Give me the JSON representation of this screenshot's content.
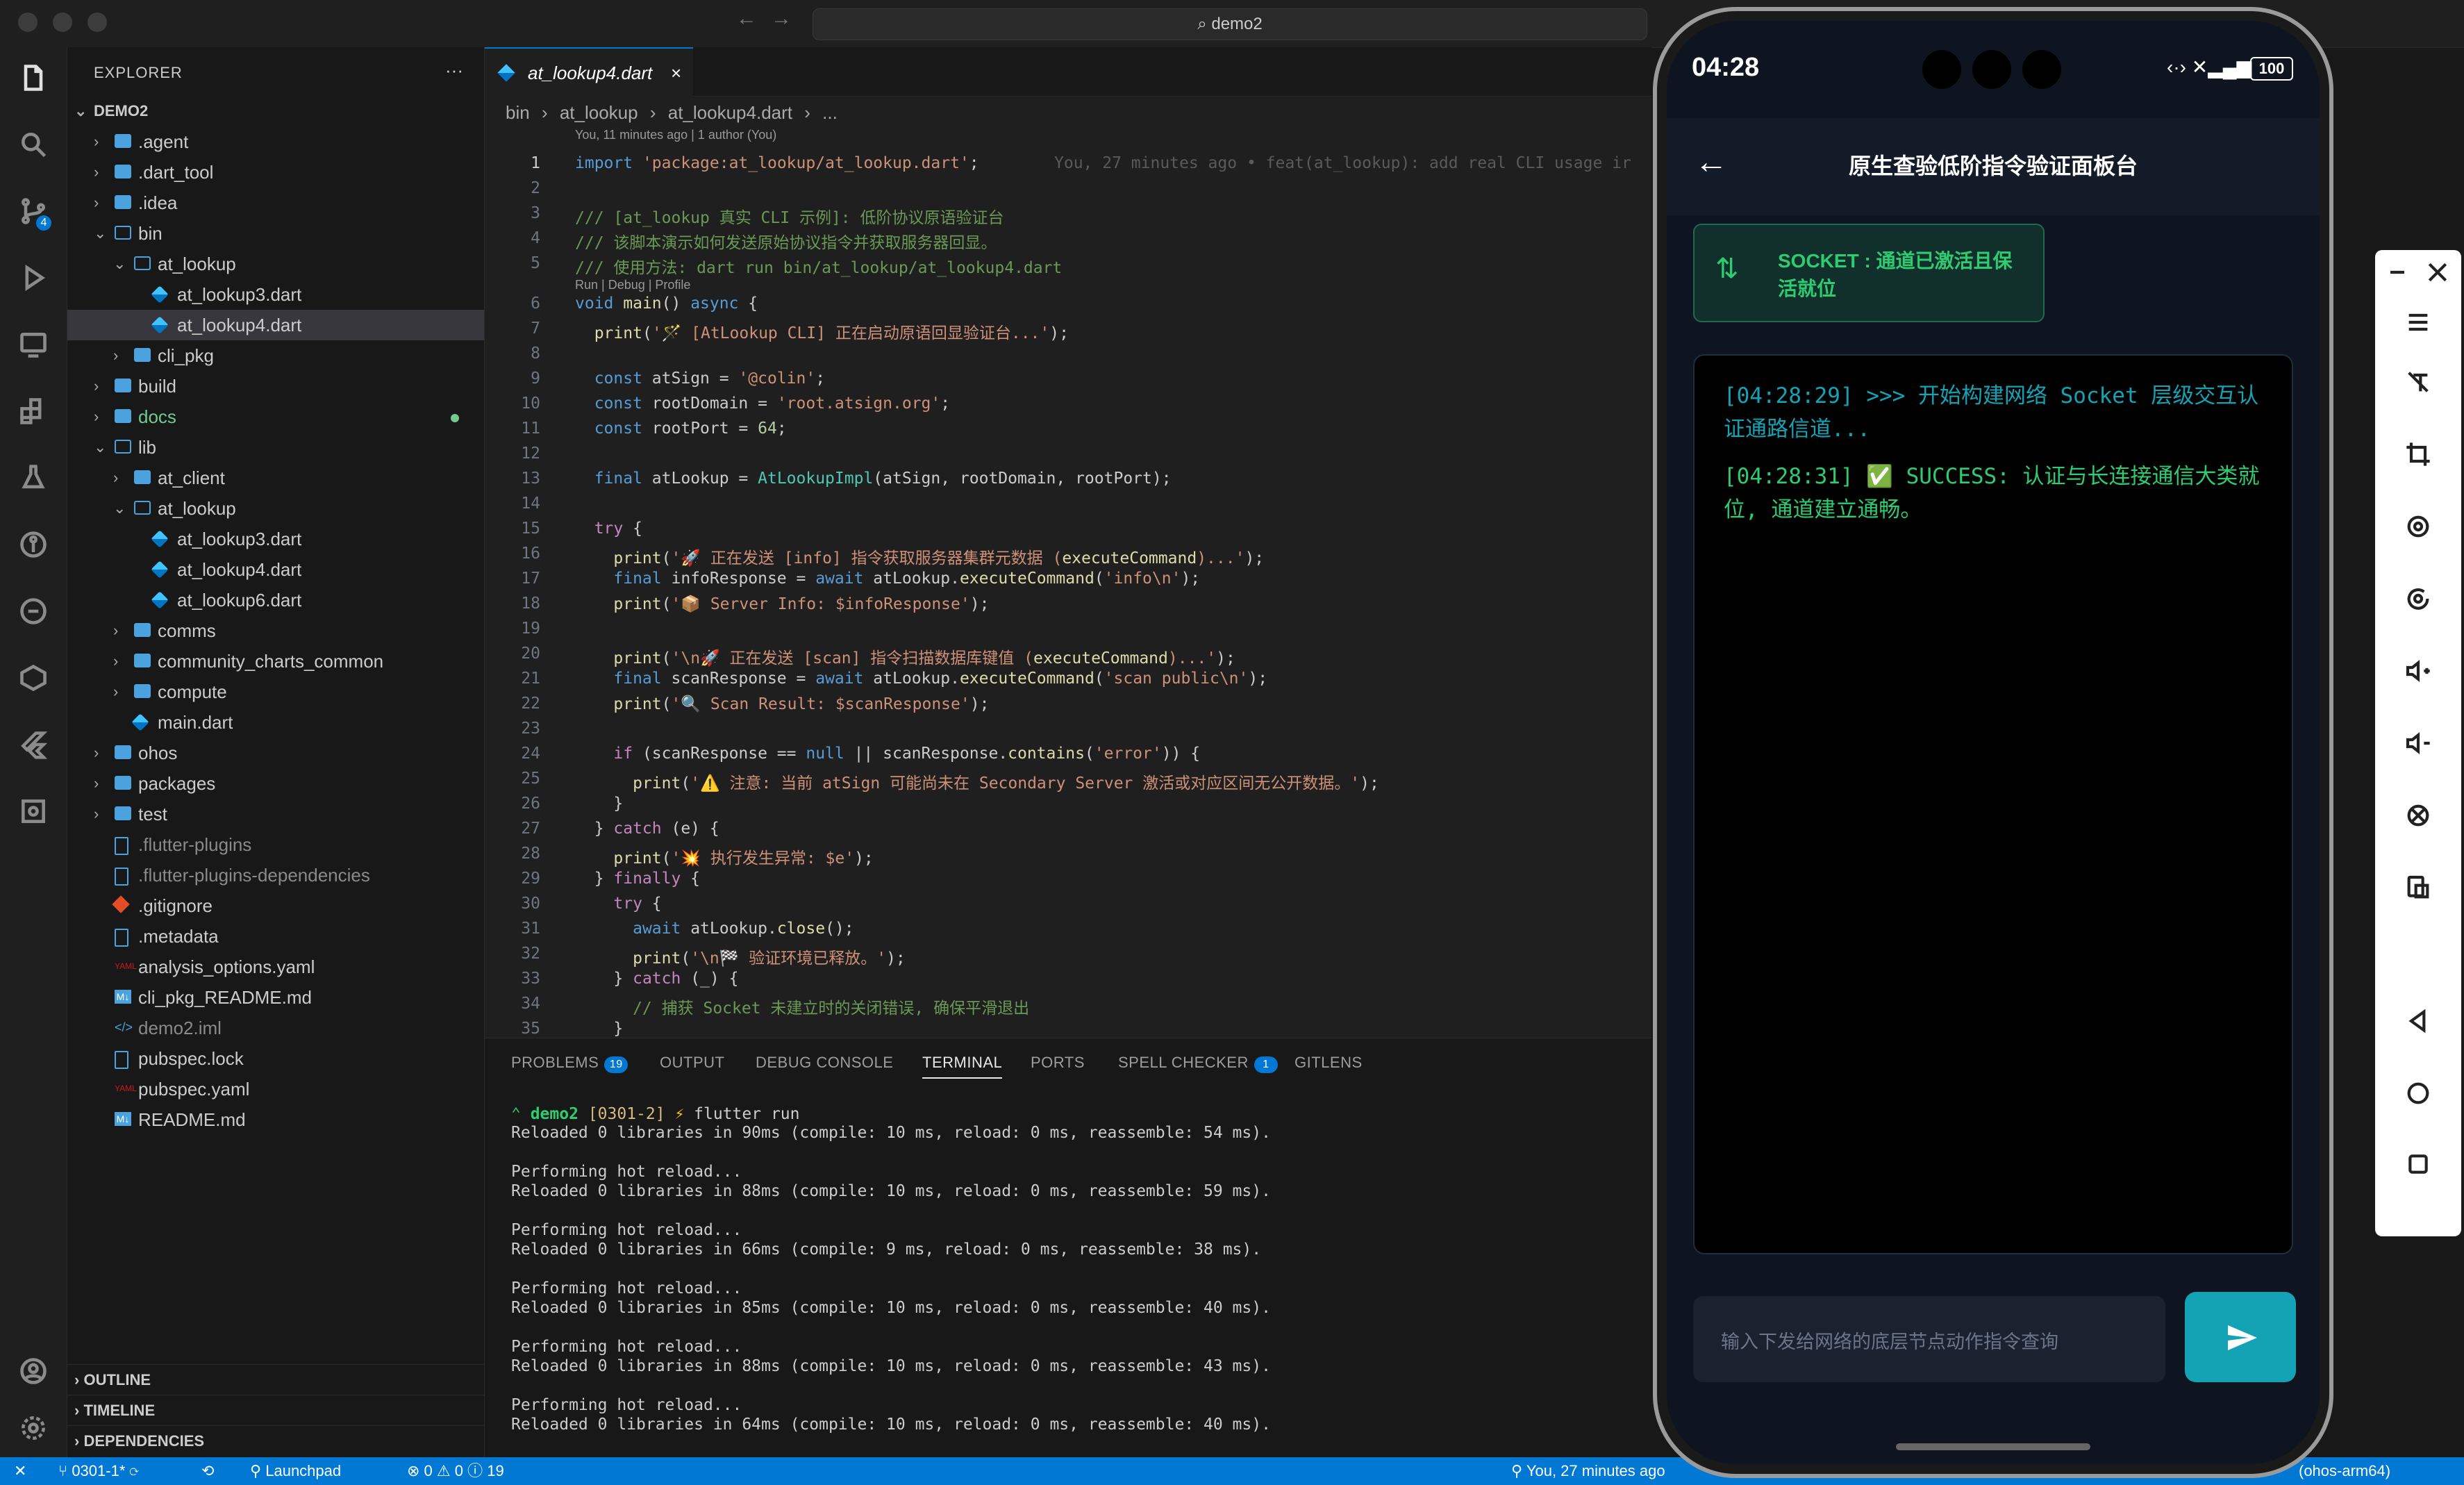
{
  "window": {
    "title": "demo2"
  },
  "explorer": {
    "title": "EXPLORER",
    "root": "DEMO2",
    "items": [
      {
        "label": ".agent",
        "type": "folder",
        "depth": 1,
        "chev": "›"
      },
      {
        "label": ".dart_tool",
        "type": "folder",
        "depth": 1,
        "chev": "›"
      },
      {
        "label": ".idea",
        "type": "folder",
        "depth": 1,
        "chev": "›"
      },
      {
        "label": "bin",
        "type": "folder",
        "depth": 1,
        "chev": "⌄"
      },
      {
        "label": "at_lookup",
        "type": "folder",
        "depth": 2,
        "chev": "⌄"
      },
      {
        "label": "at_lookup3.dart",
        "type": "dart",
        "depth": 3
      },
      {
        "label": "at_lookup4.dart",
        "type": "dart",
        "depth": 3,
        "selected": true
      },
      {
        "label": "cli_pkg",
        "type": "folder",
        "depth": 2,
        "chev": "›"
      },
      {
        "label": "build",
        "type": "folder",
        "depth": 1,
        "chev": "›"
      },
      {
        "label": "docs",
        "type": "folder",
        "depth": 1,
        "chev": "›",
        "modified": true
      },
      {
        "label": "lib",
        "type": "folder",
        "depth": 1,
        "chev": "⌄"
      },
      {
        "label": "at_client",
        "type": "folder",
        "depth": 2,
        "chev": "›"
      },
      {
        "label": "at_lookup",
        "type": "folder",
        "depth": 2,
        "chev": "⌄"
      },
      {
        "label": "at_lookup3.dart",
        "type": "dart",
        "depth": 3
      },
      {
        "label": "at_lookup4.dart",
        "type": "dart",
        "depth": 3
      },
      {
        "label": "at_lookup6.dart",
        "type": "dart",
        "depth": 3
      },
      {
        "label": "comms",
        "type": "folder",
        "depth": 2,
        "chev": "›"
      },
      {
        "label": "community_charts_common",
        "type": "folder",
        "depth": 2,
        "chev": "›"
      },
      {
        "label": "compute",
        "type": "folder",
        "depth": 2,
        "chev": "›"
      },
      {
        "label": "main.dart",
        "type": "dart",
        "depth": 2
      },
      {
        "label": "ohos",
        "type": "folder",
        "depth": 1,
        "chev": "›"
      },
      {
        "label": "packages",
        "type": "folder",
        "depth": 1,
        "chev": "›"
      },
      {
        "label": "test",
        "type": "folder",
        "depth": 1,
        "chev": "›"
      },
      {
        "label": ".flutter-plugins",
        "type": "file",
        "depth": 1,
        "dim": true
      },
      {
        "label": ".flutter-plugins-dependencies",
        "type": "file",
        "depth": 1,
        "dim": true
      },
      {
        "label": ".gitignore",
        "type": "git",
        "depth": 1
      },
      {
        "label": ".metadata",
        "type": "file",
        "depth": 1
      },
      {
        "label": "analysis_options.yaml",
        "type": "yaml",
        "depth": 1
      },
      {
        "label": "cli_pkg_README.md",
        "type": "md",
        "depth": 1
      },
      {
        "label": "demo2.iml",
        "type": "xml",
        "depth": 1,
        "dim": true
      },
      {
        "label": "pubspec.lock",
        "type": "file",
        "depth": 1
      },
      {
        "label": "pubspec.yaml",
        "type": "yaml",
        "depth": 1
      },
      {
        "label": "README.md",
        "type": "md",
        "depth": 1
      }
    ],
    "footer": [
      "OUTLINE",
      "TIMELINE",
      "DEPENDENCIES"
    ]
  },
  "editor": {
    "tab": "at_lookup4.dart",
    "breadcrumb": [
      "bin",
      "at_lookup",
      "at_lookup4.dart",
      "..."
    ],
    "blame_header": "You, 11 minutes ago | 1 author (You)",
    "blame_inline": "You, 27 minutes ago • feat(at_lookup): add real CLI usage ir",
    "codelens": "Run | Debug | Profile",
    "lines": [
      "import 'package:at_lookup/at_lookup.dart';",
      "",
      "/// [at_lookup 真实 CLI 示例]: 低阶协议原语验证台",
      "/// 该脚本演示如何发送原始协议指令并获取服务器回显。",
      "/// 使用方法: dart run bin/at_lookup/at_lookup4.dart",
      "void main() async {",
      "  print('🪄 [AtLookup CLI] 正在启动原语回显验证台...');",
      "",
      "  const atSign = '@colin';",
      "  const rootDomain = 'root.atsign.org';",
      "  const rootPort = 64;",
      "",
      "  final atLookup = AtLookupImpl(atSign, rootDomain, rootPort);",
      "",
      "  try {",
      "    print('🚀 正在发送 [info] 指令获取服务器集群元数据 (executeCommand)...');",
      "    final infoResponse = await atLookup.executeCommand('info\\n');",
      "    print('📦 Server Info: $infoResponse');",
      "",
      "    print('\\n🚀 正在发送 [scan] 指令扫描数据库键值 (executeCommand)...');",
      "    final scanResponse = await atLookup.executeCommand('scan public\\n');",
      "    print('🔍 Scan Result: $scanResponse');",
      "",
      "    if (scanResponse == null || scanResponse.contains('error')) {",
      "      print('⚠️ 注意: 当前 atSign 可能尚未在 Secondary Server 激活或对应区间无公开数据。');",
      "    }",
      "  } catch (e) {",
      "    print('💥 执行发生异常: $e');",
      "  } finally {",
      "    try {",
      "      await atLookup.close();",
      "      print('\\n🏁 验证环境已释放。');",
      "    } catch (_) {",
      "      // 捕获 Socket 未建立时的关闭错误, 确保平滑退出",
      "    }"
    ]
  },
  "panel": {
    "tabs": [
      {
        "label": "PROBLEMS",
        "badge": "19"
      },
      {
        "label": "OUTPUT"
      },
      {
        "label": "DEBUG CONSOLE"
      },
      {
        "label": "TERMINAL",
        "active": true
      },
      {
        "label": "PORTS"
      },
      {
        "label": "SPELL CHECKER",
        "badge": "1"
      },
      {
        "label": "GITLENS"
      }
    ],
    "prompt": {
      "dir": "demo2",
      "branch": "[0301-2]",
      "cmd": "flutter run"
    },
    "terminal": "Reloaded 0 libraries in 90ms (compile: 10 ms, reload: 0 ms, reassemble: 54 ms).\n\nPerforming hot reload...\nReloaded 0 libraries in 88ms (compile: 10 ms, reload: 0 ms, reassemble: 59 ms).\n\nPerforming hot reload...\nReloaded 0 libraries in 66ms (compile: 9 ms, reload: 0 ms, reassemble: 38 ms).\n\nPerforming hot reload...\nReloaded 0 libraries in 85ms (compile: 10 ms, reload: 0 ms, reassemble: 40 ms).\n\nPerforming hot reload...\nReloaded 0 libraries in 88ms (compile: 10 ms, reload: 0 ms, reassemble: 43 ms).\n\nPerforming hot reload...\nReloaded 0 libraries in 64ms (compile: 10 ms, reload: 0 ms, reassemble: 40 ms)."
  },
  "status": {
    "branch": "0301-1*",
    "launchpad": "Launchpad",
    "errors": "0",
    "warnings": "0",
    "infos": "19",
    "blame": "You, 27 minutes ago",
    "device": "(ohos-arm64)"
  },
  "phone": {
    "time": "04:28",
    "battery": "100",
    "title": "原生查验低阶指令验证面板台",
    "socket_label": "SOCKET : 通道已激活且保活就位",
    "logs": [
      {
        "time": "[04:28:29]",
        "text": ">>> 开始构建网络 Socket 层级交互认证通路信道..."
      },
      {
        "time": "[04:28:31]",
        "text": "✅ SUCCESS: 认证与长连接通信大类就位, 通道建立通畅。"
      }
    ],
    "input_placeholder": "输入下发给网络的底层节点动作指令查询",
    "accent": "#13a3b4"
  },
  "colors": {
    "accent": "#0078d4",
    "terminal_green": "#2ecc71"
  }
}
